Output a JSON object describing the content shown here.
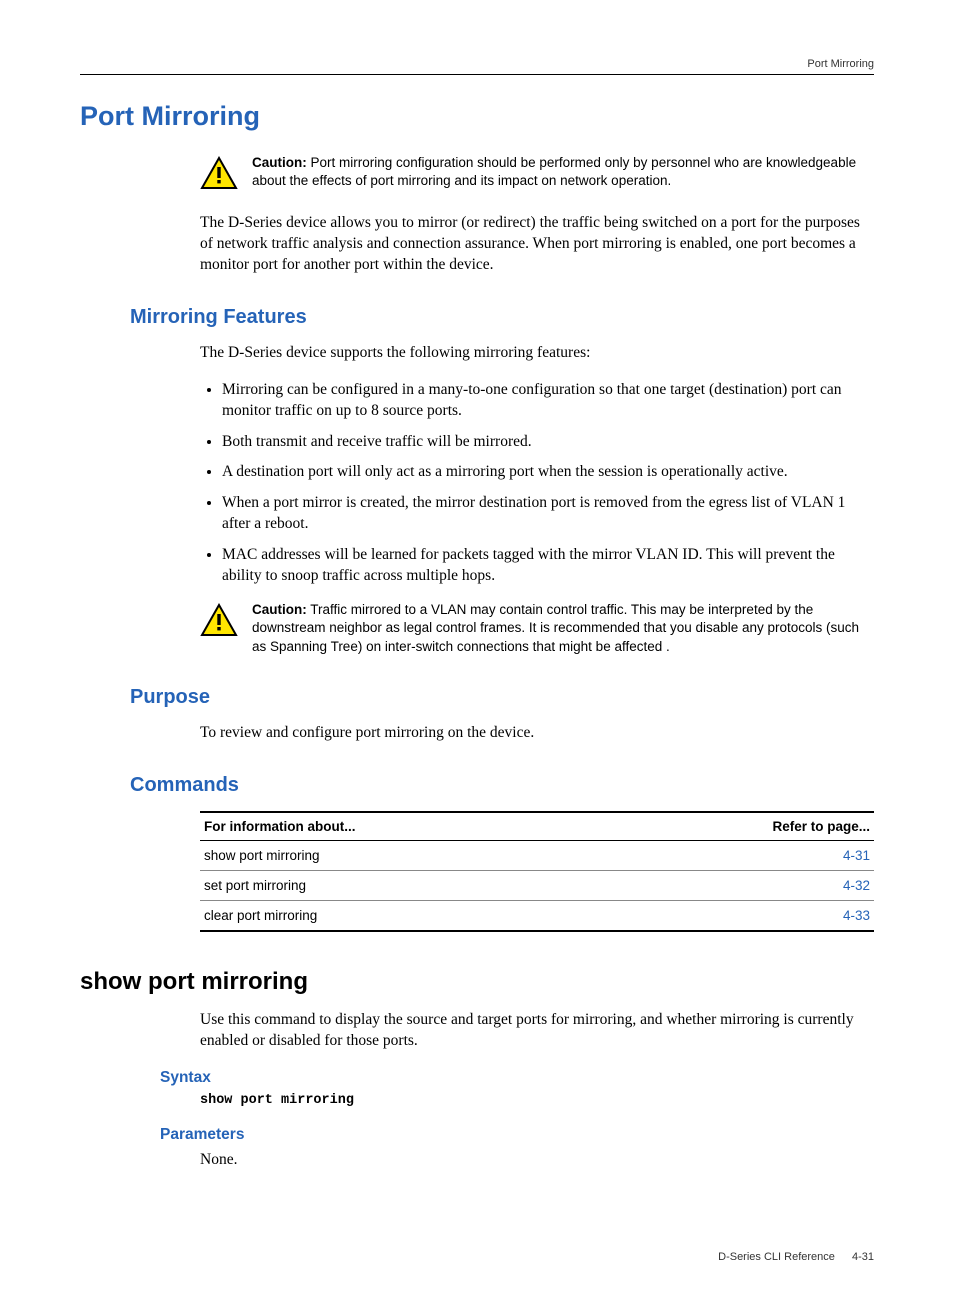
{
  "header": {
    "running_title": "Port Mirroring"
  },
  "title": "Port Mirroring",
  "caution1": {
    "label": "Caution:",
    "text": "Port mirroring configuration should be performed only by personnel who are knowledgeable about the effects of port mirroring and its impact on network operation."
  },
  "intro": "The D-Series device allows you to mirror (or redirect) the traffic being switched on a port for the purposes of network traffic analysis and connection assurance. When port mirroring is enabled, one port becomes a monitor port for another port within the device.",
  "features": {
    "heading": "Mirroring Features",
    "lead": "The D-Series device supports the following mirroring features:",
    "items": [
      "Mirroring can be configured in a many-to-one configuration so that one target (destination) port can monitor traffic on up to 8 source ports.",
      "Both transmit and receive traffic will be mirrored.",
      "A destination port will only act as a mirroring port when the session is operationally active.",
      "When a port mirror is created, the mirror destination port is removed from the egress list of VLAN 1 after a reboot.",
      "MAC addresses will be learned for packets tagged with the mirror VLAN ID. This will prevent the ability to snoop traffic across multiple hops."
    ]
  },
  "caution2": {
    "label": "Caution:",
    "text": "Traffic mirrored to a VLAN may contain control traffic. This may be interpreted by the downstream neighbor as legal control frames. It is recommended that you disable any protocols (such as Spanning Tree) on inter-switch connections that might be affected ."
  },
  "purpose": {
    "heading": "Purpose",
    "text": "To review and configure port mirroring on the device."
  },
  "commands": {
    "heading": "Commands",
    "col1": "For information about...",
    "col2": "Refer to page...",
    "rows": [
      {
        "label": "show port mirroring",
        "page": "4-31"
      },
      {
        "label": "set port mirroring",
        "page": "4-32"
      },
      {
        "label": "clear port mirroring",
        "page": "4-33"
      }
    ]
  },
  "show_cmd": {
    "heading": "show port mirroring",
    "desc": "Use this command to display the source and target ports for mirroring, and whether mirroring is currently enabled or disabled for those ports.",
    "syntax_heading": "Syntax",
    "syntax_code": "show port mirroring",
    "params_heading": "Parameters",
    "params_text": "None."
  },
  "footer": {
    "doc": "D-Series CLI Reference",
    "page": "4-31"
  }
}
